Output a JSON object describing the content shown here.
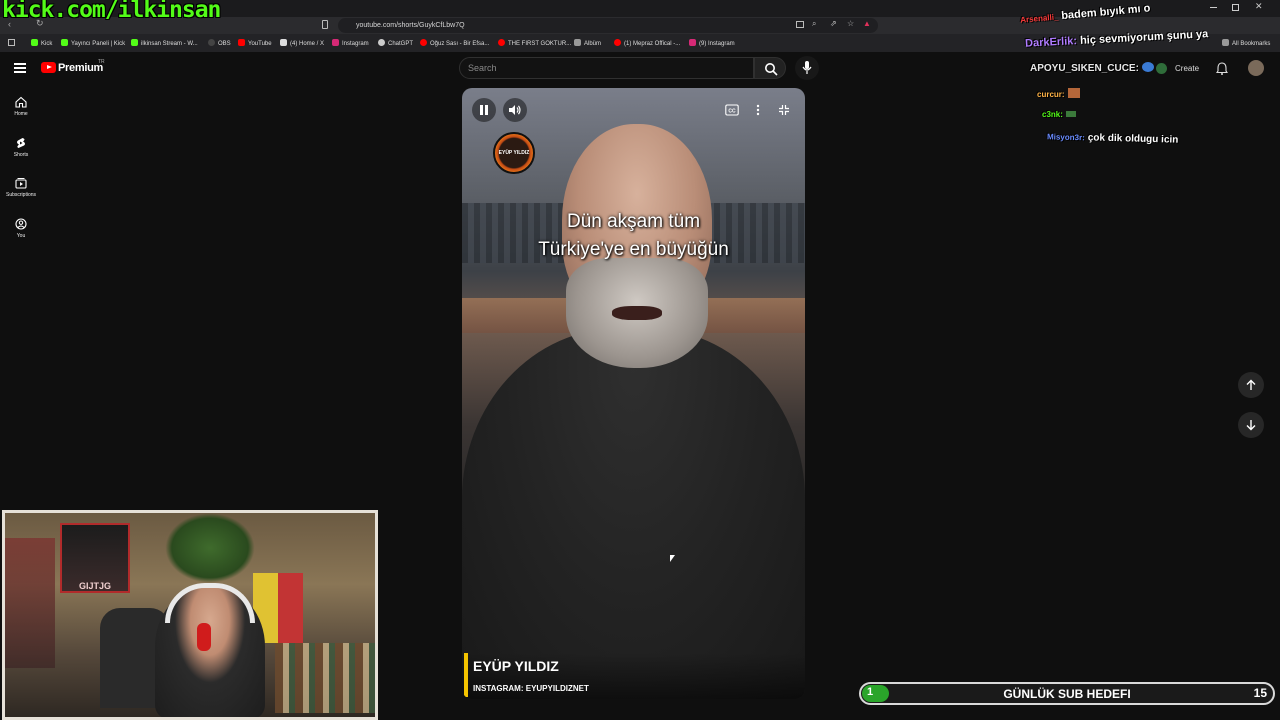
{
  "overlay": {
    "stream_url": "kick.com/ilkinsan"
  },
  "browser": {
    "url": "youtube.com/shorts/GuykCfLbw7Q",
    "all_bookmarks": "All Bookmarks",
    "bookmarks": [
      {
        "label": "Kick",
        "color": "#53fc18"
      },
      {
        "label": "Yayıncı Paneli | Kick",
        "color": "#53fc18"
      },
      {
        "label": "ilkinsan Stream - W...",
        "color": "#53fc18"
      },
      {
        "label": "OBS",
        "color": "#444444"
      },
      {
        "label": "YouTube",
        "color": "#ff0000"
      },
      {
        "label": "(4) Home / X",
        "color": "#ffffff"
      },
      {
        "label": "Instagram",
        "color": "#d62976"
      },
      {
        "label": "ChatGPT",
        "color": "#cccccc"
      },
      {
        "label": "Oğuz Sası - Bir Efsa...",
        "color": "#ff0000"
      },
      {
        "label": "THE FIRST GOKTUR...",
        "color": "#ff0000"
      },
      {
        "label": "Albüm",
        "color": "#999999"
      },
      {
        "label": "(1) Mepraz Offical -...",
        "color": "#ff0000"
      },
      {
        "label": "(9) Instagram",
        "color": "#d62976"
      }
    ]
  },
  "youtube": {
    "logo_label": "Premium",
    "region": "TR",
    "search_placeholder": "Search",
    "create_label": "Create",
    "nav": [
      {
        "label": "Home"
      },
      {
        "label": "Shorts"
      },
      {
        "label": "Subscriptions"
      },
      {
        "label": "You"
      }
    ]
  },
  "video": {
    "channel_badge": "EYÜP YILDIZ",
    "subtitle_line1": "Dün akşam tüm",
    "subtitle_line2": "Türkiye'ye en büyüğün",
    "caption_name": "EYÜP YILDIZ",
    "caption_handle": "INSTAGRAM: EYUPYILDIZNET"
  },
  "chat": {
    "messages": [
      {
        "user": "Arsenalli_",
        "text": "badem bıyık mı o",
        "user_color": "#ff3b3b"
      },
      {
        "user": "DarkErlik:",
        "text": "hiç sevmiyorum şunu ya",
        "user_color": "#b07cff"
      },
      {
        "user": "APOYU_SIKEN_CUCE:",
        "text": "",
        "user_color": "#e8e8e8"
      },
      {
        "user": "curcur:",
        "text": "",
        "user_color": "#ffb347"
      },
      {
        "user": "c3nk:",
        "text": "",
        "user_color": "#53fc18"
      },
      {
        "user": "Misyon3r:",
        "text": "çok dik oldugu icin",
        "user_color": "#6a8cff"
      }
    ]
  },
  "webcam": {
    "poster_text": "GIJTJG"
  },
  "sub_goal": {
    "current": "1",
    "title": "GÜNLÜK SUB HEDEFI",
    "target": "15",
    "progress": 0.067,
    "fill_color": "#2aa52a"
  }
}
